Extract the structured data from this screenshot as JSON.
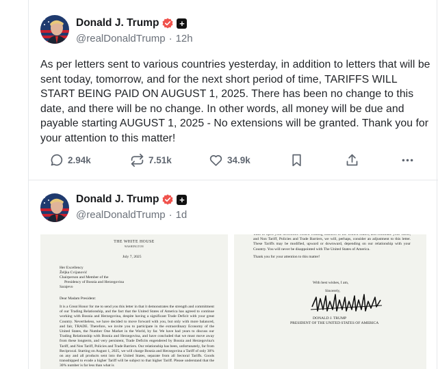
{
  "posts": [
    {
      "author": {
        "name": "Donald J. Trump",
        "handle": "@realDonaldTrump",
        "time": "12h"
      },
      "text": "As per letters sent to various countries yesterday, in addition to letters that will be sent today, tomorrow, and for the next short period of time, TARIFFS WILL START BEING PAID ON AUGUST 1, 2025. There has been no change to this date, and there will be no change. In other words, all money will be due and payable starting AUGUST 1, 2025 - No extensions will be granted. Thank you for your attention to this matter!",
      "stats": {
        "replies": "2.94k",
        "retruths": "7.51k",
        "likes": "34.9k"
      }
    },
    {
      "author": {
        "name": "Donald J. Trump",
        "handle": "@realDonaldTrump",
        "time": "1d"
      },
      "letter_page1": {
        "letterhead": "THE WHITE HOUSE",
        "city": "WASHINGTON",
        "date": "July 7, 2025",
        "addressee": [
          "Her Excellency",
          "Željka Cvijanović",
          "Chairperson and Member of the",
          "Presidency of Bosnia and Herzegovina",
          "Sarajevo"
        ],
        "salutation": "Dear Madam President:",
        "para1": "It is a Great Honor for me to send you this letter in that it demonstrates the strength and commitment of our Trading Relationship, and the fact that the United States of America has agreed to continue working with Bosnia and Herzegovina, despite having a significant Trade Deficit with your great Country. Nevertheless, we have decided to move forward with you, but only with more balanced, and fair, TRADE. Therefore, we invite you to participate in the extraordinary Economy of the United States, the Number One Market in the World, by far. We have had years to discuss our Trading Relationship with Bosnia and Herzegovina, and have concluded that we must move away from these longterm, and very persistent, Trade Deficits engendered by Bosnia and Herzegovina's Tariff, and Non Tariff, Policies and Trade Barriers. Our relationship has been, unfortunately, far from Reciprocal. Starting on August 1, 2025, we will charge Bosnia and Herzegovina a Tariff of only 30% on any and all products sent into the United States, separate from all Sectoral Tariffs. Goods transshipped to evade a higher Tariff will be subject to that higher Tariff. Please understand that the 30% number is far less than what is"
      },
      "letter_page2": {
        "top": "want to open your heretofore closed Trading Markets to the United States, and eliminate your Tariff, and Non Tariff, Policies and Trade Barriers, we will, perhaps, consider an adjustment to this letter. These Tariffs may be modified, upward or downward, depending on our relationship with your Country. You will never be disappointed with The United States of America.",
        "thanks": "Thank you for your attention to this matter!",
        "wishes": "With best wishes, I am,",
        "closing": "Sincerely,",
        "signer": "DONALD J. TRUMP",
        "signer_title": "PRESIDENT OF THE UNITED STATES OF AMERICA"
      }
    }
  ],
  "colors": {
    "verified": "#f0534d",
    "muted": "#6a7079",
    "border": "#e6e8eb"
  }
}
